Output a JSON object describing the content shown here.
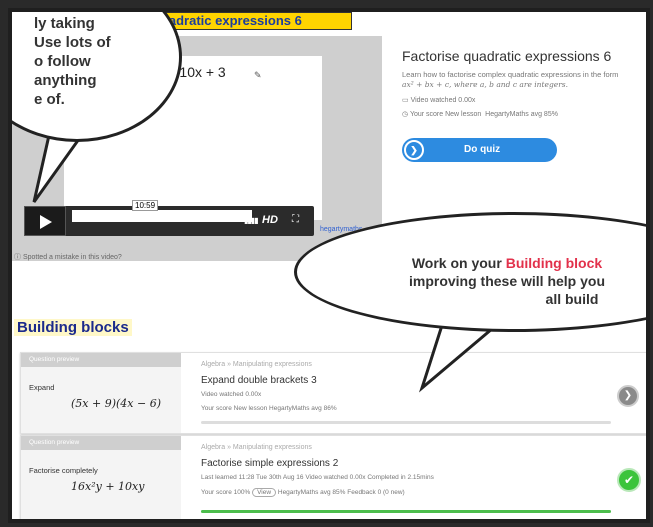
{
  "video": {
    "title": "quadratic expressions 6",
    "expression": "8x² + 10x + 3",
    "time": "10:59",
    "hd": "HD",
    "watermark": "hegartymaths",
    "mistake": "Spotted a mistake in this video?"
  },
  "lesson": {
    "title": "Factorise quadratic expressions 6",
    "desc_prefix": "Learn how to factorise complex quadratic expressions in the form",
    "desc_formula": "ax² + bx + c, where a, b and c are integers.",
    "video_watched": "Video watched 0.00x",
    "score": "Your score New lesson",
    "avg": "HegartyMaths avg 85%",
    "do_quiz": "Do quiz"
  },
  "building_blocks": {
    "heading": "Building blocks",
    "cards": [
      {
        "preview": "Question preview",
        "instruction": "Expand",
        "maths": "(5x + 9)(4x − 6)",
        "crumb": "Algebra  »  Manipulating expressions",
        "title": "Expand double brackets 3",
        "meta1": "Video watched 0.00x",
        "meta2": "Your score New lesson    HegartyMaths avg 86%",
        "progress": 0,
        "action": "arrow"
      },
      {
        "preview": "Question preview",
        "instruction": "Factorise completely",
        "maths": "16x²y + 10xy",
        "crumb": "Algebra  »  Manipulating expressions",
        "title": "Factorise simple expressions 2",
        "meta1": "Last learned 11:28 Tue 30th Aug 16     Video watched 0.00x     Completed in 2.15mins",
        "score": "Your score 100%",
        "view": "View",
        "meta2": "HegartyMaths avg 85%     Feedback 0 (0 new)",
        "progress": 1.0,
        "action": "check"
      }
    ]
  },
  "bubbles": {
    "left_text": "ly taking\nUse lots of\no follow\nanything\ne of.",
    "right_prefix": "Work on your ",
    "right_highlight": "Building block",
    "right_line2": "improving these will help you",
    "right_line3": "all build"
  },
  "colors": {
    "accent": "#2d8be0",
    "success": "#3cc43c",
    "highlight": "#e2314b"
  }
}
